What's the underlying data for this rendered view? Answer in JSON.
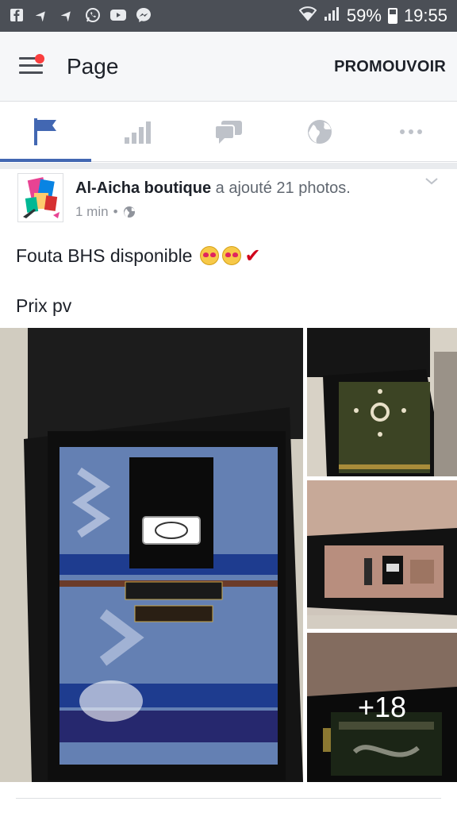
{
  "status_bar": {
    "left_icons": [
      "facebook-icon",
      "navigation-icon",
      "navigation-icon",
      "whatsapp-icon",
      "youtube-icon",
      "messenger-icon"
    ],
    "battery_percent": "59%",
    "time": "19:55"
  },
  "app_bar": {
    "title": "Page",
    "promote_label": "PROMOUVOIR"
  },
  "tabs": [
    {
      "icon": "flag-icon",
      "active": true
    },
    {
      "icon": "bar-chart-icon",
      "active": false
    },
    {
      "icon": "chat-bubbles-icon",
      "active": false
    },
    {
      "icon": "globe-icon",
      "active": false
    },
    {
      "icon": "more-icon",
      "active": false
    }
  ],
  "post": {
    "author": "Al-Aicha boutique",
    "action": "a ajouté 21 photos.",
    "time": "1 min",
    "privacy_icon": "globe-icon",
    "text_line1": "Fouta BHS disponible",
    "text_line2": "Prix pv",
    "more_photos_label": "+18"
  },
  "colors": {
    "status_bar": "#4b4f56",
    "app_bar": "#f6f7f9",
    "accent": "#4267b2",
    "inactive_icon": "#bec2c9"
  }
}
